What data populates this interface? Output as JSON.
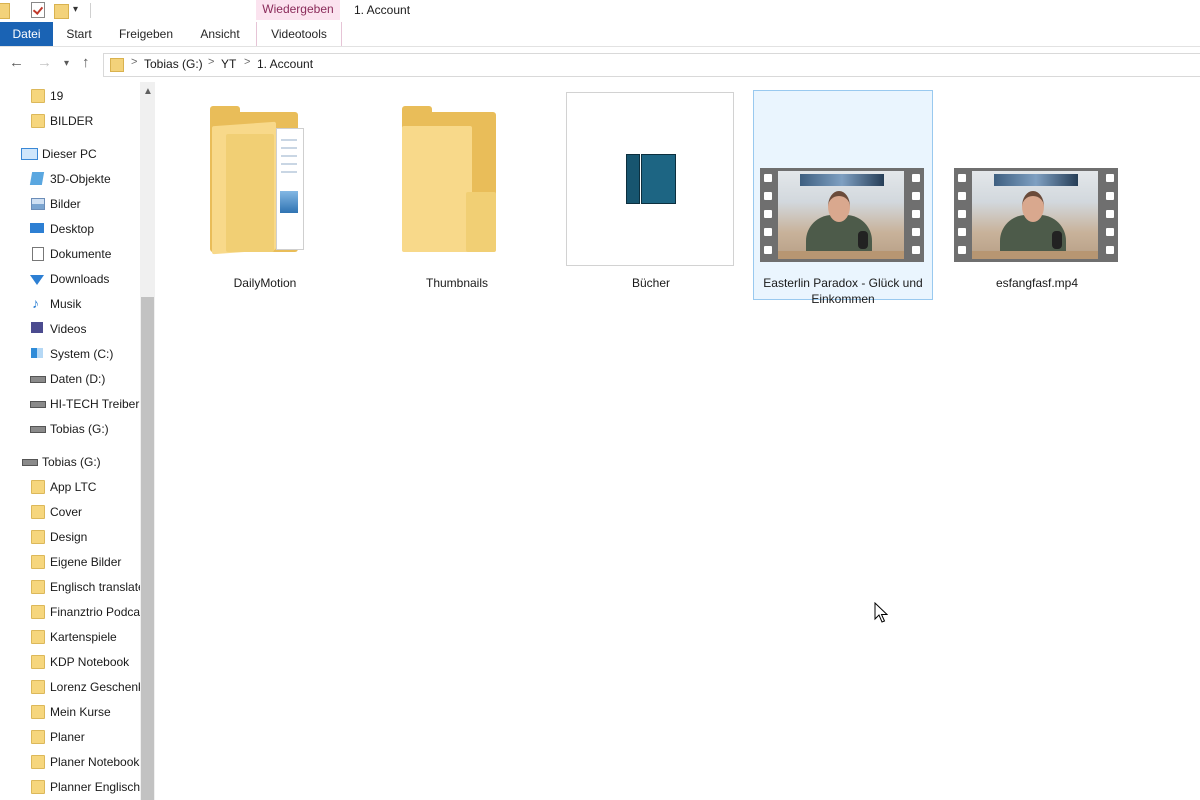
{
  "window": {
    "title": "1. Account",
    "context_tab_header": "Wiedergeben"
  },
  "ribbon": {
    "tabs": [
      "Datei",
      "Start",
      "Freigeben",
      "Ansicht",
      "Videotools"
    ]
  },
  "address": {
    "crumbs": [
      "Tobias (G:)",
      "YT",
      "1. Account"
    ],
    "separator": ">"
  },
  "sidebar": {
    "items": [
      {
        "label": "19",
        "icon": "folder-icon"
      },
      {
        "label": "BILDER",
        "icon": "folder-icon"
      },
      {
        "label": "Dieser PC",
        "icon": "computer-icon"
      },
      {
        "label": "3D-Objekte",
        "icon": "3d-objects-icon"
      },
      {
        "label": "Bilder",
        "icon": "pictures-icon"
      },
      {
        "label": "Desktop",
        "icon": "desktop-icon"
      },
      {
        "label": "Dokumente",
        "icon": "documents-icon"
      },
      {
        "label": "Downloads",
        "icon": "downloads-icon"
      },
      {
        "label": "Musik",
        "icon": "music-icon"
      },
      {
        "label": "Videos",
        "icon": "videos-icon"
      },
      {
        "label": "System (C:)",
        "icon": "system-drive-icon"
      },
      {
        "label": "Daten (D:)",
        "icon": "drive-icon"
      },
      {
        "label": "HI-TECH Treiber (",
        "icon": "drive-icon"
      },
      {
        "label": "Tobias (G:)",
        "icon": "drive-icon"
      },
      {
        "label": "Tobias (G:)",
        "icon": "drive-icon"
      },
      {
        "label": "App LTC",
        "icon": "folder-icon"
      },
      {
        "label": "Cover",
        "icon": "folder-icon"
      },
      {
        "label": "Design",
        "icon": "folder-icon"
      },
      {
        "label": "Eigene Bilder",
        "icon": "folder-icon"
      },
      {
        "label": "Englisch translate",
        "icon": "folder-icon"
      },
      {
        "label": "Finanztrio Podca",
        "icon": "folder-icon"
      },
      {
        "label": "Kartenspiele",
        "icon": "folder-icon"
      },
      {
        "label": "KDP Notebook",
        "icon": "folder-icon"
      },
      {
        "label": "Lorenz Geschenk",
        "icon": "folder-icon"
      },
      {
        "label": "Mein Kurse",
        "icon": "folder-icon"
      },
      {
        "label": "Planer",
        "icon": "folder-icon"
      },
      {
        "label": "Planer Notebook",
        "icon": "folder-icon"
      },
      {
        "label": "Planner Englisch",
        "icon": "folder-icon"
      }
    ]
  },
  "files": [
    {
      "name": "DailyMotion",
      "type": "folder-with-documents"
    },
    {
      "name": "Thumbnails",
      "type": "folder"
    },
    {
      "name": "Bücher",
      "type": "folder-thumbnail"
    },
    {
      "name": "Easterlin Paradox - Glück und Einkommen",
      "type": "video",
      "selected": true
    },
    {
      "name": "esfangfasf.mp4",
      "type": "video"
    }
  ],
  "colors": {
    "file_tab": "#1a63b4",
    "context_tab": "#fbe3ef",
    "selection": "#eaf5fe",
    "folder": "#f8d98a"
  }
}
